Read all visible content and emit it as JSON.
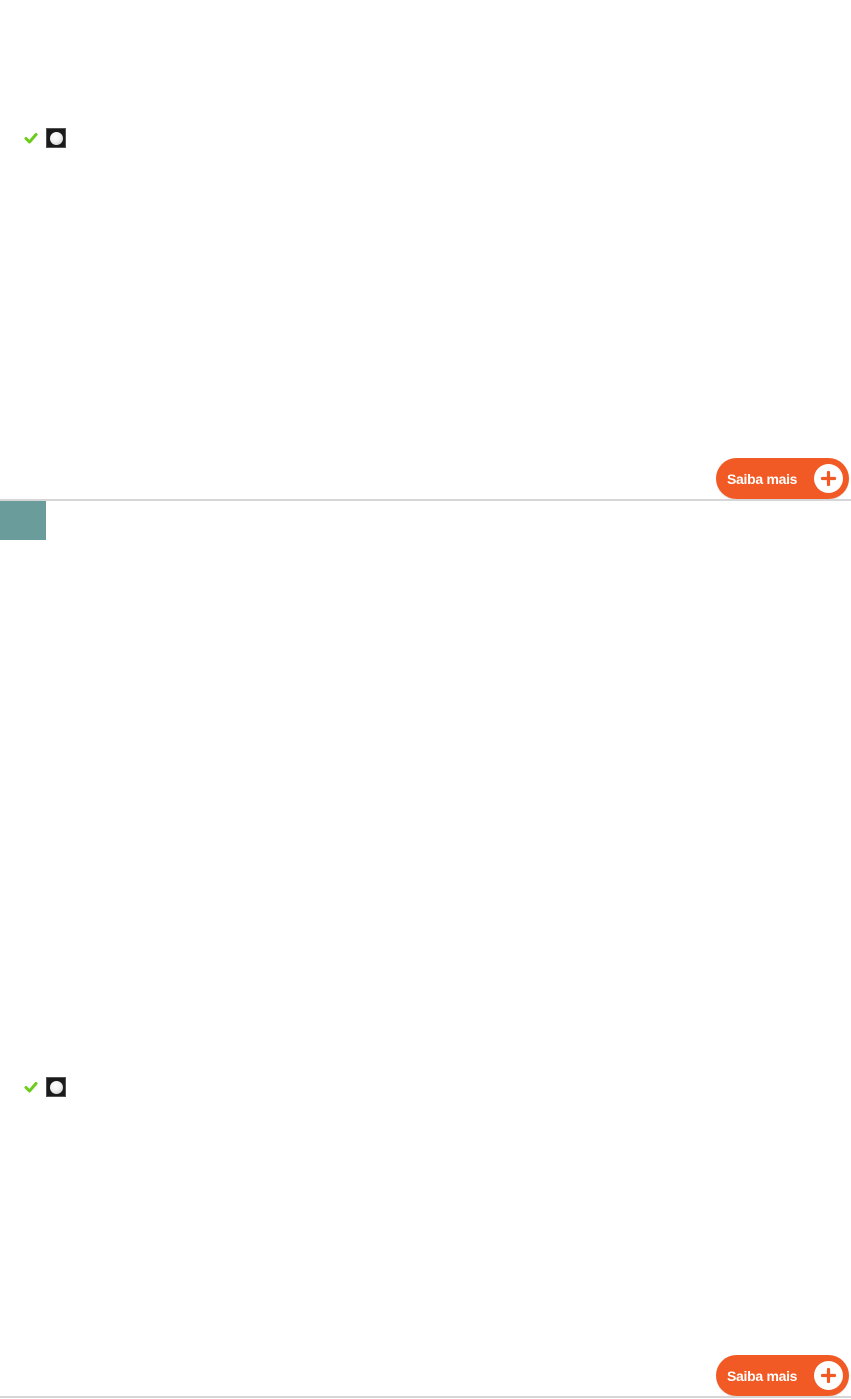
{
  "items": [
    {
      "status_icon": "check-icon",
      "selector_icon": "radio-icon",
      "more_button": {
        "label": "Saiba mais",
        "icon": "plus-circle-icon"
      }
    },
    {
      "status_icon": "check-icon",
      "selector_icon": "radio-icon",
      "more_button": {
        "label": "Saiba mais",
        "icon": "plus-circle-icon"
      }
    }
  ],
  "colors": {
    "button": "#f15a24",
    "check": "#6ccc1c",
    "divider": "#d6d6d6",
    "accent_block": "#6a9c9c"
  }
}
